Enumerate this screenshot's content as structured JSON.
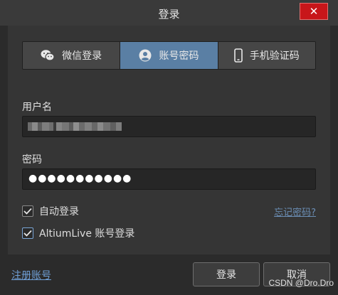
{
  "window": {
    "title": "登录",
    "close_label": "✕"
  },
  "tabs": [
    {
      "label": "微信登录",
      "icon": "wechat-icon",
      "active": false
    },
    {
      "label": "账号密码",
      "icon": "user-icon",
      "active": true
    },
    {
      "label": "手机验证码",
      "icon": "phone-icon",
      "active": false
    }
  ],
  "form": {
    "username_label": "用户名",
    "password_label": "密码",
    "password_value": "●●●●●●●●●●●",
    "auto_login_label": "自动登录",
    "altium_login_label": "AltiumLive 账号登录",
    "auto_login_checked": true,
    "altium_login_checked": true,
    "forgot_password": "忘记密码?"
  },
  "footer": {
    "register": "注册账号",
    "login_button": "登录",
    "cancel_button": "取消"
  },
  "watermark": "CSDN @Dro.Dro",
  "colors": {
    "accent": "#5a7fa4",
    "close": "#c8161a",
    "link": "#6f9fd6"
  }
}
